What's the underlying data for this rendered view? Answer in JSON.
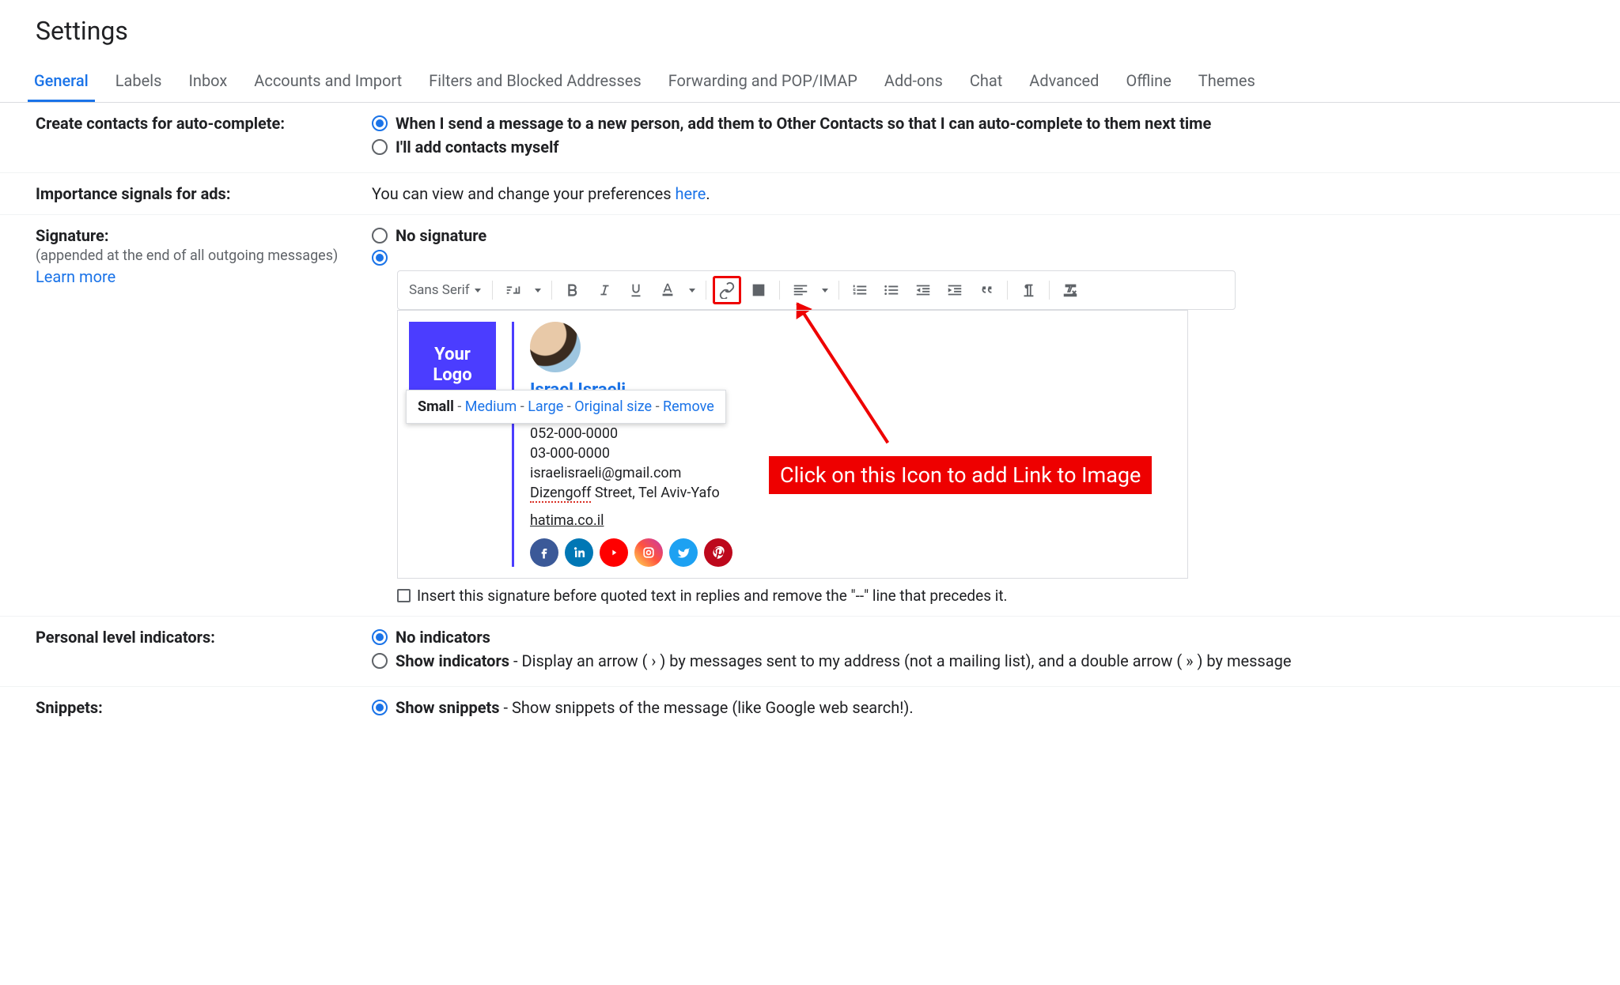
{
  "title": "Settings",
  "tabs": [
    "General",
    "Labels",
    "Inbox",
    "Accounts and Import",
    "Filters and Blocked Addresses",
    "Forwarding and POP/IMAP",
    "Add-ons",
    "Chat",
    "Advanced",
    "Offline",
    "Themes"
  ],
  "active_tab_index": 0,
  "auto_complete": {
    "label": "Create contacts for auto-complete:",
    "opt1": "When I send a message to a new person, add them to Other Contacts so that I can auto-complete to them next time",
    "opt2": "I'll add contacts myself",
    "selected": 0
  },
  "ads": {
    "label": "Importance signals for ads:",
    "text_prefix": "You can view and change your preferences ",
    "link": "here",
    "suffix": "."
  },
  "signature": {
    "label": "Signature:",
    "sub": "(appended at the end of all outgoing messages)",
    "learn_more": "Learn more",
    "no_sig": "No signature",
    "selected": 1,
    "font_name": "Sans Serif",
    "logo_text": "Your\nLogo",
    "name": "Israel Israeli",
    "phone1": "052-000-0000",
    "phone2": "03-000-0000",
    "email": "israelisraeli@gmail.com",
    "street_prefix": "Dizengoff",
    "street_rest": " Street, Tel Aviv-Yafo",
    "website": "hatima.co.il",
    "size_options": {
      "small": "Small",
      "medium": "Medium",
      "large": "Large",
      "original": "Original size",
      "remove": "Remove"
    },
    "insert_before": "Insert this signature before quoted text in replies and remove the \"--\" line that precedes it."
  },
  "indicators": {
    "label": "Personal level indicators:",
    "opt1": "No indicators",
    "opt2_bold": "Show indicators",
    "opt2_rest": " - Display an arrow ( › ) by messages sent to my address (not a mailing list), and a double arrow ( » ) by message",
    "selected": 0
  },
  "snippets": {
    "label": "Snippets:",
    "opt1_bold": "Show snippets",
    "opt1_rest": " - Show snippets of the message (like Google web search!).",
    "selected": 0
  },
  "annotation": "Click on this Icon to add Link to Image"
}
